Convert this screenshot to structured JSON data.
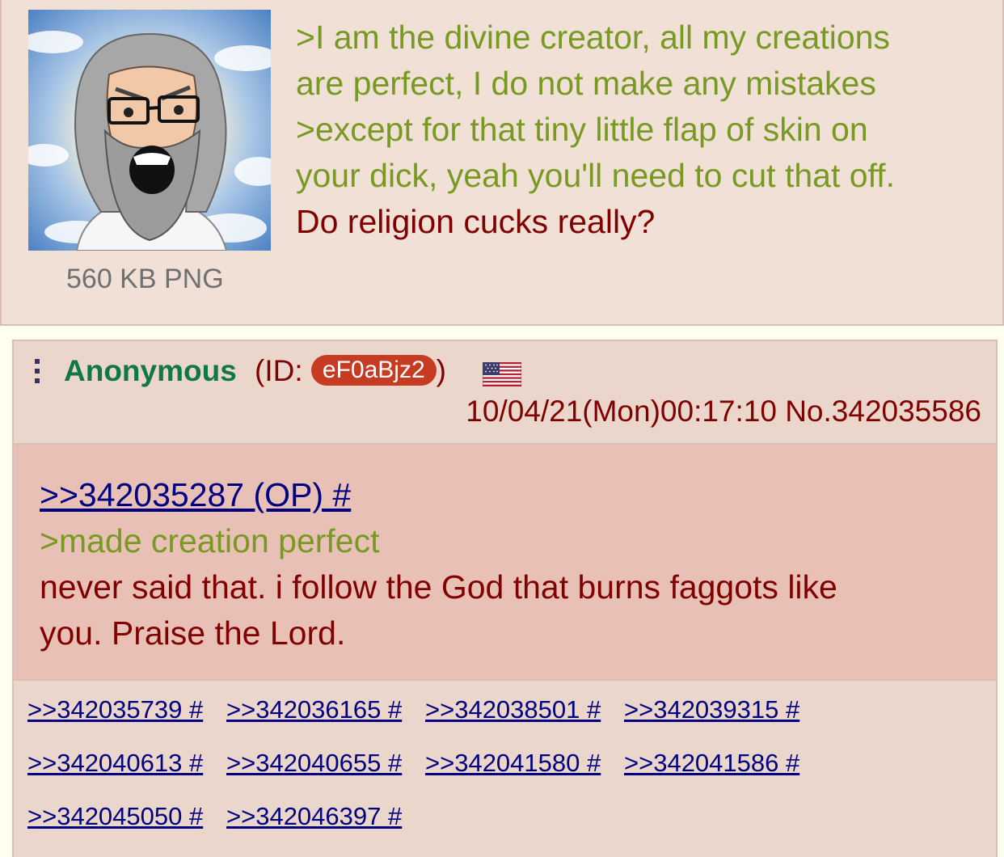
{
  "op": {
    "file_size": "560 KB PNG",
    "lines": [
      {
        "text": ">I am the divine creator, all my creations",
        "green": true
      },
      {
        "text": "are perfect, I do not make any mistakes",
        "green": true
      },
      {
        "text": ">except for that tiny little flap of skin on",
        "green": true
      },
      {
        "text": "your dick, yeah you'll need to cut that off.",
        "green": true
      },
      {
        "text": "Do religion cucks really?",
        "green": false
      }
    ]
  },
  "reply": {
    "name": "Anonymous",
    "id_prefix": "(ID: ",
    "id": "eF0aBjz2",
    "id_suffix": ")",
    "datetime": "10/04/21(Mon)00:17:10 No.342035586",
    "quote_link": ">>342035287 (OP) #",
    "greentext": ">made creation perfect",
    "body_line1": "never said that. i follow the God that burns faggots like",
    "body_line2": "you. Praise the Lord.",
    "backlinks_row1": [
      ">>342035739 #",
      ">>342036165 #",
      ">>342038501 #",
      ">>342039315 #"
    ],
    "backlinks_row2": [
      ">>342040613 #",
      ">>342040655 #",
      ">>342041580 #",
      ">>342041586 #"
    ],
    "backlinks_row3": [
      ">>342045050 #",
      ">>342046397 #"
    ]
  },
  "icons": {
    "thumbnail": "bearded-god-wojak-image",
    "menu": "vertical-dots-menu-icon",
    "flag": "us-flag-icon"
  },
  "colors": {
    "post_bg": "#f0e0d6",
    "highlight_bg": "#e8c0b5",
    "greentext": "#789922",
    "name": "#117743",
    "text": "#800000",
    "link": "#000080",
    "id_badge": "#c63b22"
  }
}
